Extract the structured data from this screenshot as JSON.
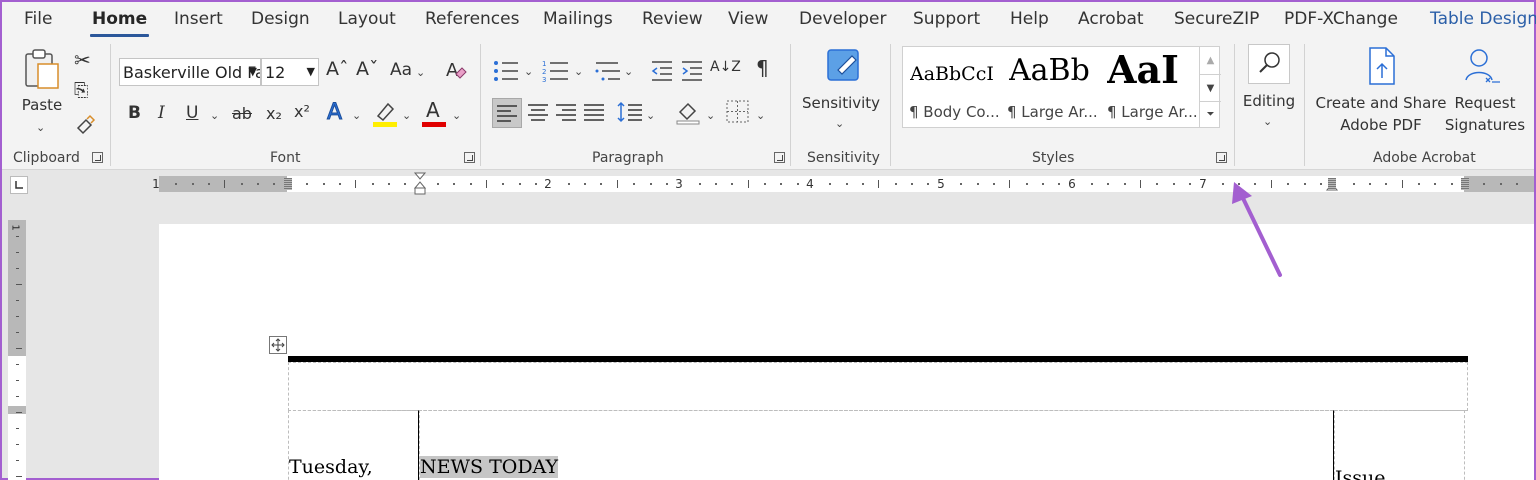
{
  "tabs": [
    "File",
    "Home",
    "Insert",
    "Design",
    "Layout",
    "References",
    "Mailings",
    "Review",
    "View",
    "Developer",
    "Support",
    "Help",
    "Acrobat",
    "SecureZIP",
    "PDF-XChange",
    "Table Design"
  ],
  "active_tab": "Home",
  "clipboard": {
    "paste_label": "Paste",
    "group_label": "Clipboard"
  },
  "font": {
    "font_name": "Baskerville Old Fa",
    "font_size": "12",
    "group_label": "Font",
    "grow_glyph": "Aˆ",
    "shrink_glyph": "Aˇ",
    "case_glyph": "Aa",
    "bold": "B",
    "italic": "I",
    "underline": "U",
    "strike": "ab",
    "subscript": "x₂",
    "superscript": "x²",
    "text_effects": "A",
    "font_color": "A",
    "highlight_color": "#ffee00",
    "font_color_hex": "#e00000"
  },
  "paragraph": {
    "group_label": "Paragraph",
    "pilcrow": "¶",
    "sort": "A↓Z"
  },
  "sensitivity": {
    "button_label": "Sensitivity",
    "group_label": "Sensitivity"
  },
  "styles": {
    "group_label": "Styles",
    "items": [
      {
        "preview": "AaBbCcI",
        "name": "¶ Body Co..."
      },
      {
        "preview": "AaBb",
        "name": "¶ Large Ar..."
      },
      {
        "preview": "AaI",
        "name": "¶ Large Ar..."
      }
    ]
  },
  "editing": {
    "label": "Editing"
  },
  "adobe": {
    "create_share_line1": "Create and Share",
    "create_share_line2": "Adobe PDF",
    "request_line1": "Request",
    "request_line2": "Signatures",
    "group_label": "Adobe Acrobat"
  },
  "ruler": {
    "numbers": [
      "1",
      "1",
      "2",
      "3",
      "4",
      "5",
      "6",
      "7"
    ]
  },
  "document": {
    "cell_date": "Tuesday,",
    "cell_title": "NEWS TODAY",
    "cell_issue": "Issue"
  },
  "colors": {
    "accent": "#2b579a",
    "annotation_arrow": "#a35fd0"
  }
}
